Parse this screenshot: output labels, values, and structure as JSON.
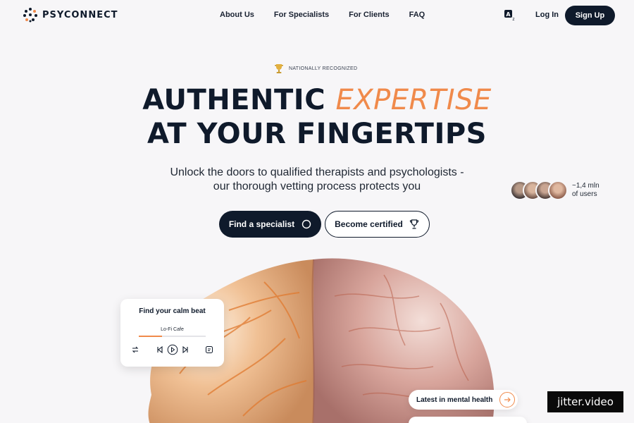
{
  "nav": {
    "brand": "PSYCONNECT",
    "menu": [
      "About Us",
      "For Specialists",
      "For Clients",
      "FAQ"
    ],
    "login": "Log In",
    "signup": "Sign Up"
  },
  "hero": {
    "badge": "NATIONALLY RECOGNIZED",
    "title_line1_a": "AUTHENTIC ",
    "title_line1_b": "EXPERTISE",
    "title_line2": "AT YOUR FINGERTIPS",
    "subtitle_line1": "Unlock the doors to qualified therapists and psychologists -",
    "subtitle_line2": "our thorough vetting process protects you",
    "btn_find": "Find a specialist",
    "btn_cert": "Become certified"
  },
  "users": {
    "line1": "~1,4 mln",
    "line2": "of users"
  },
  "music": {
    "title": "Find your calm beat",
    "track": "Lo-Fi Cafe",
    "progress": 0.35
  },
  "latest": {
    "label": "Latest in mental health"
  },
  "watermark": "jitter.video",
  "colors": {
    "accent": "#f08a4b",
    "dark": "#0f1a2b",
    "background": "#f7f6f8"
  },
  "icons": [
    "logo-dots-icon",
    "translate-icon",
    "circle-icon",
    "trophy-icon",
    "repeat-icon",
    "prev-icon",
    "play-icon",
    "next-icon",
    "playlist-icon",
    "arrow-right-icon",
    "award-icon"
  ]
}
